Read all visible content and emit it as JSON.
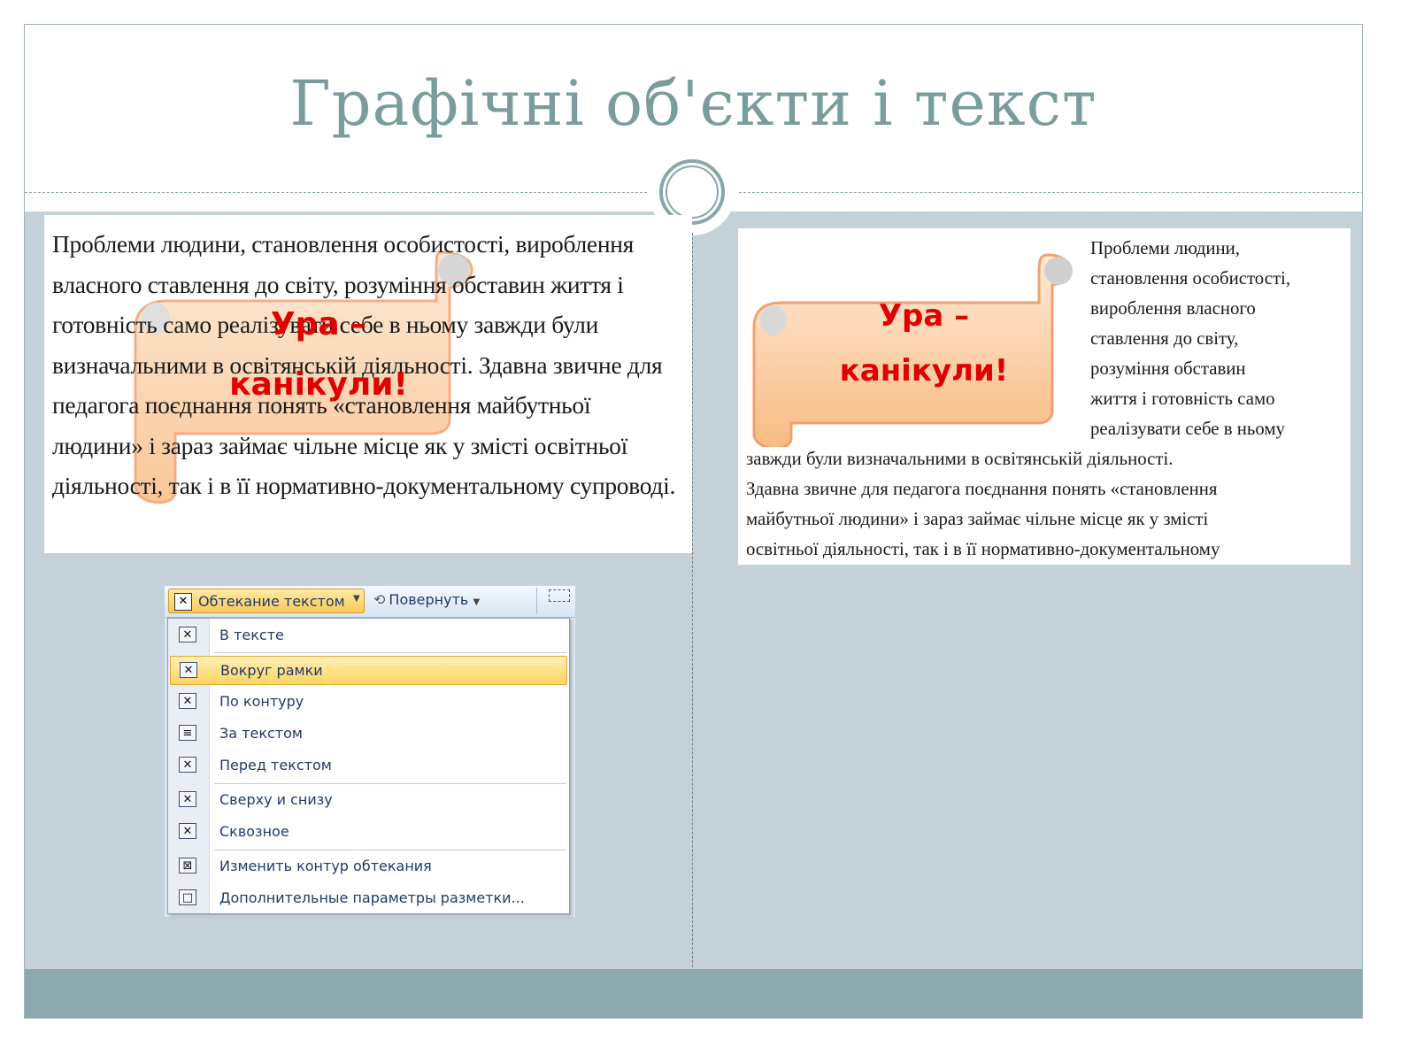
{
  "slide": {
    "title": "Графічні об'єкти і текст"
  },
  "left_doc": {
    "text": "Проблеми людини, становлення особистості, вироблення власного ставлення до світу, розуміння обставин життя і готовність само реалізувати себе в ньому завжди були визначальними в освітянській діяльності. Здавна звичне для педагога поєднання понять «становлення майбутньої людини» і зараз займає чільне місце як у змісті освітньої діяльності, так і в її нормативно-документальному супроводі.",
    "banner_line1": "Ура –",
    "banner_line2": "канікули!"
  },
  "right_doc": {
    "banner_line1": "Ура –",
    "banner_line2": "канікули!",
    "wrapped_lines": [
      "Проблеми людини,",
      "становлення особистості,",
      "вироблення власного",
      "ставлення до світу,",
      "розуміння обставин",
      "життя і готовність само",
      "реалізувати себе в ньому"
    ],
    "full_lines": [
      "завжди були визначальними в освітянській діяльності.",
      "Здавна звичне для педагога поєднання понять «становлення",
      "майбутньої людини» і зараз займає чільне місце як у змісті",
      "освітньої діяльності, так і в її нормативно-документальному"
    ]
  },
  "menu": {
    "wrap_button_label": "Обтекание текстом",
    "rotate_button_label": "Повернуть",
    "items": [
      {
        "label": "В тексте",
        "icon": "inline-wrap-icon"
      },
      {
        "label": "Вокруг рамки",
        "icon": "square-wrap-icon"
      },
      {
        "label": "По контуру",
        "icon": "tight-wrap-icon"
      },
      {
        "label": "За текстом",
        "icon": "behind-text-icon"
      },
      {
        "label": "Перед текстом",
        "icon": "in-front-text-icon"
      },
      {
        "label": "Сверху и снизу",
        "icon": "top-bottom-wrap-icon"
      },
      {
        "label": "Сквозное",
        "icon": "through-wrap-icon"
      },
      {
        "label": "Изменить контур обтекания",
        "icon": "edit-wrap-points-icon"
      },
      {
        "label": "Дополнительные параметры разметки...",
        "icon": "layout-options-icon"
      }
    ],
    "selected_item": "Вокруг рамки"
  },
  "colors": {
    "title": "#7b9c9c",
    "slide_bg": "#c4d1d8",
    "footer": "#8ba8ad",
    "banner_text": "#e00000",
    "banner_fill": "#fbd0a8",
    "menu_highlight": "#fcd45f"
  }
}
